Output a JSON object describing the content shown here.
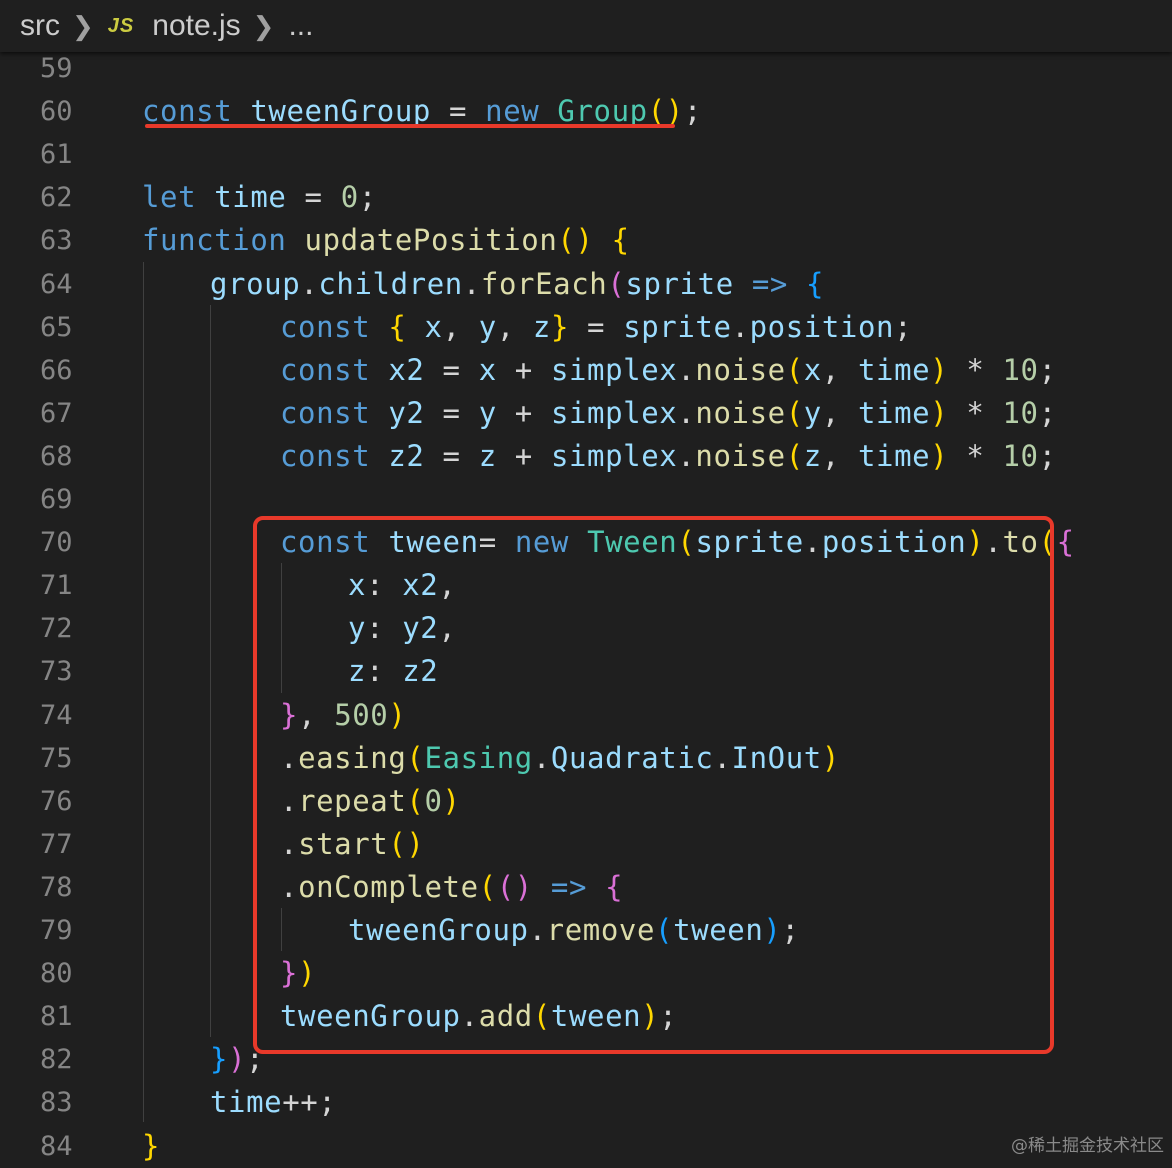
{
  "breadcrumb": {
    "folder": "src",
    "file_icon": "JS",
    "file": "note.js",
    "more": "..."
  },
  "code_lines": [
    {
      "n": "59",
      "indent": 0,
      "tokens": []
    },
    {
      "n": "60",
      "indent": 0,
      "tokens": [
        [
          "kw",
          "const"
        ],
        [
          "op",
          " "
        ],
        [
          "var",
          "tweenGroup"
        ],
        [
          "op",
          " = "
        ],
        [
          "kw",
          "new"
        ],
        [
          "op",
          " "
        ],
        [
          "cls",
          "Group"
        ],
        [
          "p1",
          "()"
        ],
        [
          "op",
          ";"
        ]
      ]
    },
    {
      "n": "61",
      "indent": 0,
      "tokens": []
    },
    {
      "n": "62",
      "indent": 0,
      "tokens": [
        [
          "kw",
          "let"
        ],
        [
          "op",
          " "
        ],
        [
          "var",
          "time"
        ],
        [
          "op",
          " = "
        ],
        [
          "num",
          "0"
        ],
        [
          "op",
          ";"
        ]
      ]
    },
    {
      "n": "63",
      "indent": 0,
      "tokens": [
        [
          "kw",
          "function"
        ],
        [
          "op",
          " "
        ],
        [
          "fn",
          "updatePosition"
        ],
        [
          "p1",
          "()"
        ],
        [
          "op",
          " "
        ],
        [
          "p1",
          "{"
        ]
      ]
    },
    {
      "n": "64",
      "indent": 1,
      "tokens": [
        [
          "var",
          "group"
        ],
        [
          "op",
          "."
        ],
        [
          "var",
          "children"
        ],
        [
          "op",
          "."
        ],
        [
          "fn",
          "forEach"
        ],
        [
          "p2",
          "("
        ],
        [
          "var",
          "sprite"
        ],
        [
          "op",
          " "
        ],
        [
          "kw",
          "=>"
        ],
        [
          "op",
          " "
        ],
        [
          "p3",
          "{"
        ]
      ]
    },
    {
      "n": "65",
      "indent": 2,
      "tokens": [
        [
          "kw",
          "const"
        ],
        [
          "op",
          " "
        ],
        [
          "p1",
          "{"
        ],
        [
          "op",
          " "
        ],
        [
          "var",
          "x"
        ],
        [
          "op",
          ", "
        ],
        [
          "var",
          "y"
        ],
        [
          "op",
          ", "
        ],
        [
          "var",
          "z"
        ],
        [
          "p1",
          "}"
        ],
        [
          "op",
          " = "
        ],
        [
          "var",
          "sprite"
        ],
        [
          "op",
          "."
        ],
        [
          "var",
          "position"
        ],
        [
          "op",
          ";"
        ]
      ]
    },
    {
      "n": "66",
      "indent": 2,
      "tokens": [
        [
          "kw",
          "const"
        ],
        [
          "op",
          " "
        ],
        [
          "var",
          "x2"
        ],
        [
          "op",
          " = "
        ],
        [
          "var",
          "x"
        ],
        [
          "op",
          " + "
        ],
        [
          "var",
          "simplex"
        ],
        [
          "op",
          "."
        ],
        [
          "fn",
          "noise"
        ],
        [
          "p1",
          "("
        ],
        [
          "var",
          "x"
        ],
        [
          "op",
          ", "
        ],
        [
          "var",
          "time"
        ],
        [
          "p1",
          ")"
        ],
        [
          "op",
          " * "
        ],
        [
          "num",
          "10"
        ],
        [
          "op",
          ";"
        ]
      ]
    },
    {
      "n": "67",
      "indent": 2,
      "tokens": [
        [
          "kw",
          "const"
        ],
        [
          "op",
          " "
        ],
        [
          "var",
          "y2"
        ],
        [
          "op",
          " = "
        ],
        [
          "var",
          "y"
        ],
        [
          "op",
          " + "
        ],
        [
          "var",
          "simplex"
        ],
        [
          "op",
          "."
        ],
        [
          "fn",
          "noise"
        ],
        [
          "p1",
          "("
        ],
        [
          "var",
          "y"
        ],
        [
          "op",
          ", "
        ],
        [
          "var",
          "time"
        ],
        [
          "p1",
          ")"
        ],
        [
          "op",
          " * "
        ],
        [
          "num",
          "10"
        ],
        [
          "op",
          ";"
        ]
      ]
    },
    {
      "n": "68",
      "indent": 2,
      "tokens": [
        [
          "kw",
          "const"
        ],
        [
          "op",
          " "
        ],
        [
          "var",
          "z2"
        ],
        [
          "op",
          " = "
        ],
        [
          "var",
          "z"
        ],
        [
          "op",
          " + "
        ],
        [
          "var",
          "simplex"
        ],
        [
          "op",
          "."
        ],
        [
          "fn",
          "noise"
        ],
        [
          "p1",
          "("
        ],
        [
          "var",
          "z"
        ],
        [
          "op",
          ", "
        ],
        [
          "var",
          "time"
        ],
        [
          "p1",
          ")"
        ],
        [
          "op",
          " * "
        ],
        [
          "num",
          "10"
        ],
        [
          "op",
          ";"
        ]
      ]
    },
    {
      "n": "69",
      "indent": 0,
      "tokens": []
    },
    {
      "n": "70",
      "indent": 2,
      "tokens": [
        [
          "kw",
          "const"
        ],
        [
          "op",
          " "
        ],
        [
          "var",
          "tween"
        ],
        [
          "op",
          "= "
        ],
        [
          "kw",
          "new"
        ],
        [
          "op",
          " "
        ],
        [
          "cls",
          "Tween"
        ],
        [
          "p1",
          "("
        ],
        [
          "var",
          "sprite"
        ],
        [
          "op",
          "."
        ],
        [
          "var",
          "position"
        ],
        [
          "p1",
          ")"
        ],
        [
          "op",
          "."
        ],
        [
          "fn",
          "to"
        ],
        [
          "p1",
          "("
        ],
        [
          "p2",
          "{"
        ]
      ]
    },
    {
      "n": "71",
      "indent": 3,
      "tokens": [
        [
          "var",
          "x"
        ],
        [
          "op",
          ": "
        ],
        [
          "var",
          "x2"
        ],
        [
          "op",
          ","
        ]
      ]
    },
    {
      "n": "72",
      "indent": 3,
      "tokens": [
        [
          "var",
          "y"
        ],
        [
          "op",
          ": "
        ],
        [
          "var",
          "y2"
        ],
        [
          "op",
          ","
        ]
      ]
    },
    {
      "n": "73",
      "indent": 3,
      "tokens": [
        [
          "var",
          "z"
        ],
        [
          "op",
          ": "
        ],
        [
          "var",
          "z2"
        ]
      ]
    },
    {
      "n": "74",
      "indent": 2,
      "tokens": [
        [
          "p2",
          "}"
        ],
        [
          "op",
          ", "
        ],
        [
          "num",
          "500"
        ],
        [
          "p1",
          ")"
        ]
      ]
    },
    {
      "n": "75",
      "indent": 2,
      "tokens": [
        [
          "op",
          "."
        ],
        [
          "fn",
          "easing"
        ],
        [
          "p1",
          "("
        ],
        [
          "cls",
          "Easing"
        ],
        [
          "op",
          "."
        ],
        [
          "var",
          "Quadratic"
        ],
        [
          "op",
          "."
        ],
        [
          "var",
          "InOut"
        ],
        [
          "p1",
          ")"
        ]
      ]
    },
    {
      "n": "76",
      "indent": 2,
      "tokens": [
        [
          "op",
          "."
        ],
        [
          "fn",
          "repeat"
        ],
        [
          "p1",
          "("
        ],
        [
          "num",
          "0"
        ],
        [
          "p1",
          ")"
        ]
      ]
    },
    {
      "n": "77",
      "indent": 2,
      "tokens": [
        [
          "op",
          "."
        ],
        [
          "fn",
          "start"
        ],
        [
          "p1",
          "()"
        ]
      ]
    },
    {
      "n": "78",
      "indent": 2,
      "tokens": [
        [
          "op",
          "."
        ],
        [
          "fn",
          "onComplete"
        ],
        [
          "p1",
          "("
        ],
        [
          "p2",
          "()"
        ],
        [
          "op",
          " "
        ],
        [
          "kw",
          "=>"
        ],
        [
          "op",
          " "
        ],
        [
          "p2",
          "{"
        ]
      ]
    },
    {
      "n": "79",
      "indent": 3,
      "tokens": [
        [
          "var",
          "tweenGroup"
        ],
        [
          "op",
          "."
        ],
        [
          "fn",
          "remove"
        ],
        [
          "p3",
          "("
        ],
        [
          "var",
          "tween"
        ],
        [
          "p3",
          ")"
        ],
        [
          "op",
          ";"
        ]
      ]
    },
    {
      "n": "80",
      "indent": 2,
      "tokens": [
        [
          "p2",
          "}"
        ],
        [
          "p1",
          ")"
        ]
      ]
    },
    {
      "n": "81",
      "indent": 2,
      "tokens": [
        [
          "var",
          "tweenGroup"
        ],
        [
          "op",
          "."
        ],
        [
          "fn",
          "add"
        ],
        [
          "p1",
          "("
        ],
        [
          "var",
          "tween"
        ],
        [
          "p1",
          ")"
        ],
        [
          "op",
          ";"
        ]
      ]
    },
    {
      "n": "82",
      "indent": 1,
      "tokens": [
        [
          "p3",
          "}"
        ],
        [
          "p2",
          ")"
        ],
        [
          "op",
          ";"
        ]
      ]
    },
    {
      "n": "83",
      "indent": 1,
      "tokens": [
        [
          "var",
          "time"
        ],
        [
          "op",
          "++;"
        ]
      ]
    },
    {
      "n": "84",
      "indent": 0,
      "tokens": [
        [
          "p1",
          "}"
        ]
      ]
    }
  ],
  "annotations": {
    "underline_color": "#e8392a",
    "box_color": "#e8392a"
  },
  "watermark": "@稀土掘金技术社区"
}
